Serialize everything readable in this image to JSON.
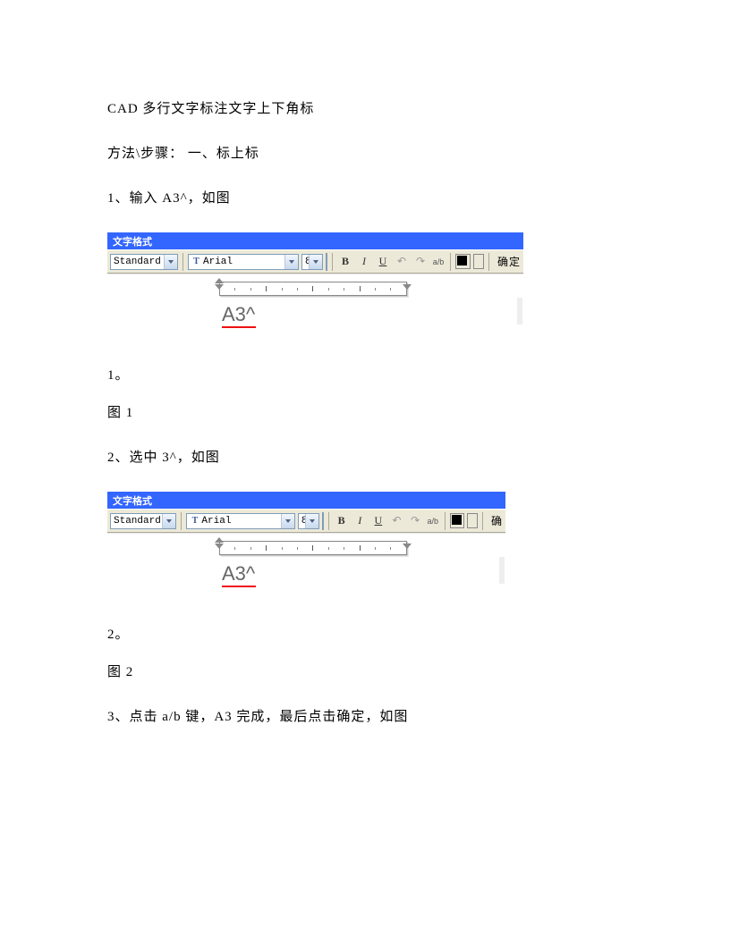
{
  "doc": {
    "title": "CAD 多行文字标注文字上下角标",
    "method_heading": "方法\\步骤： 一、标上标",
    "step1": "1、输入 A3^，如图",
    "fig1_after_a": "1。",
    "fig1_caption": "图 1",
    "step2": "2、选中 3^，如图",
    "fig2_after_a": "2。",
    "fig2_caption": "图 2",
    "step3": "3、点击 a/b 键，A3 完成，最后点击确定，如图"
  },
  "toolbar": {
    "titlebar": "文字格式",
    "style": "Standard",
    "font_prefix": "T",
    "font": "Arial",
    "size": "8",
    "bold": "B",
    "italic": "I",
    "underline": "U",
    "frac": "a/b",
    "ok": "确定",
    "ok_short": "确"
  },
  "canvas": {
    "sample_text": "A3^"
  }
}
